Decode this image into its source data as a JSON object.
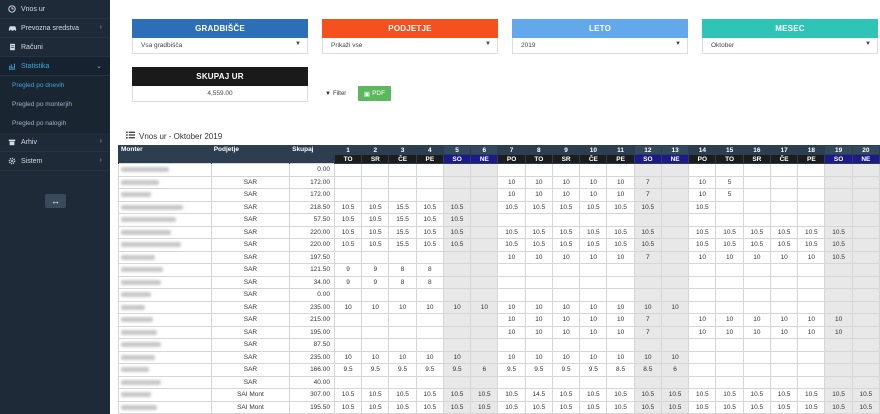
{
  "sidebar": {
    "items": [
      {
        "label": "Vnos ur",
        "icon": "clock-icon",
        "chevron": false
      },
      {
        "label": "Prevozna sredstva",
        "icon": "car-icon",
        "chevron": true
      },
      {
        "label": "Računi",
        "icon": "document-icon",
        "chevron": false
      },
      {
        "label": "Statistika",
        "icon": "chart-icon",
        "chevron": true,
        "active": true
      }
    ],
    "sub_items": [
      {
        "label": "Pregled po dnevih",
        "active": true
      },
      {
        "label": "Pregled po monterjih"
      },
      {
        "label": "Pregled po nalogih"
      }
    ],
    "bottom_items": [
      {
        "label": "Arhiv",
        "icon": "archive-icon",
        "chevron": true
      },
      {
        "label": "Sistem",
        "icon": "gear-icon",
        "chevron": true
      }
    ],
    "toggle_icon": "arrows-horizontal-icon"
  },
  "filters": {
    "gradbisce": {
      "title": "GRADBIŠČE",
      "value": "Vsa gradbišča",
      "color": "#2c6fb7"
    },
    "podjetje": {
      "title": "PODJETJE",
      "value": "Prikaži vse",
      "color": "#f4511e"
    },
    "leto": {
      "title": "LETO",
      "value": "2019",
      "color": "#64a8ec"
    },
    "mesec": {
      "title": "MESEC",
      "value": "Oktober",
      "color": "#2ec4b6"
    }
  },
  "total": {
    "title": "SKUPAJ UR",
    "value": "4,559.00",
    "color": "#1a1a1a"
  },
  "buttons": {
    "filter_label": "Filter",
    "pdf_label": "PDF",
    "pdf_color": "#5cb85c"
  },
  "table": {
    "title": "Vnos ur - Oktober 2019",
    "headers": {
      "monter": "Monter",
      "podjetje": "Podjetje",
      "skupaj": "Skupaj"
    },
    "days": [
      "1",
      "2",
      "3",
      "4",
      "5",
      "6",
      "7",
      "8",
      "9",
      "10",
      "11",
      "12",
      "13",
      "14",
      "15",
      "16",
      "17",
      "18",
      "19",
      "20"
    ],
    "dows": [
      "TO",
      "SR",
      "ČE",
      "PE",
      "SO",
      "NE",
      "PO",
      "TO",
      "SR",
      "ČE",
      "PE",
      "SO",
      "NE",
      "PO",
      "TO",
      "SR",
      "ČE",
      "PE",
      "SO",
      "NE"
    ],
    "rows": [
      {
        "podjetje": "",
        "skupaj": "0.00",
        "h": [
          "",
          "",
          "",
          "",
          "",
          "",
          "",
          "",
          "",
          "",
          "",
          "",
          "",
          "",
          "",
          "",
          "",
          "",
          "",
          ""
        ]
      },
      {
        "podjetje": "SAR",
        "skupaj": "172.00",
        "h": [
          "",
          "",
          "",
          "",
          "",
          "",
          "10",
          "10",
          "10",
          "10",
          "10",
          "7",
          "",
          "10",
          "5",
          "",
          "",
          "",
          "",
          ""
        ]
      },
      {
        "podjetje": "SAR",
        "skupaj": "172.00",
        "h": [
          "",
          "",
          "",
          "",
          "",
          "",
          "10",
          "10",
          "10",
          "10",
          "10",
          "7",
          "",
          "10",
          "5",
          "",
          "",
          "",
          "",
          ""
        ]
      },
      {
        "podjetje": "SAR",
        "skupaj": "218.50",
        "h": [
          "10.5",
          "10.5",
          "15.5",
          "10.5",
          "10.5",
          "",
          "10.5",
          "10.5",
          "10.5",
          "10.5",
          "10.5",
          "10.5",
          "",
          "10.5",
          "",
          "",
          "",
          "",
          "",
          ""
        ]
      },
      {
        "podjetje": "SAR",
        "skupaj": "57.50",
        "h": [
          "10.5",
          "10.5",
          "15.5",
          "10.5",
          "10.5",
          "",
          "",
          "",
          "",
          "",
          "",
          "",
          "",
          "",
          "",
          "",
          "",
          "",
          "",
          ""
        ]
      },
      {
        "podjetje": "SAR",
        "skupaj": "220.00",
        "h": [
          "10.5",
          "10.5",
          "15.5",
          "10.5",
          "10.5",
          "",
          "10.5",
          "10.5",
          "10.5",
          "10.5",
          "10.5",
          "10.5",
          "",
          "10.5",
          "10.5",
          "10.5",
          "10.5",
          "10.5",
          "10.5",
          ""
        ]
      },
      {
        "podjetje": "SAR",
        "skupaj": "220.00",
        "h": [
          "10.5",
          "10.5",
          "15.5",
          "10.5",
          "10.5",
          "",
          "10.5",
          "10.5",
          "10.5",
          "10.5",
          "10.5",
          "10.5",
          "",
          "10.5",
          "10.5",
          "10.5",
          "10.5",
          "10.5",
          "10.5",
          ""
        ]
      },
      {
        "podjetje": "SAR",
        "skupaj": "197.50",
        "h": [
          "",
          "",
          "",
          "",
          "",
          "",
          "10",
          "10",
          "10",
          "10",
          "10",
          "7",
          "",
          "10",
          "10",
          "10",
          "10",
          "10",
          "10.5",
          ""
        ]
      },
      {
        "podjetje": "SAR",
        "skupaj": "121.50",
        "h": [
          "9",
          "9",
          "8",
          "8",
          "",
          "",
          "",
          "",
          "",
          "",
          "",
          "",
          "",
          "",
          "",
          "",
          "",
          "",
          "",
          ""
        ]
      },
      {
        "podjetje": "SAR",
        "skupaj": "34.00",
        "h": [
          "9",
          "9",
          "8",
          "8",
          "",
          "",
          "",
          "",
          "",
          "",
          "",
          "",
          "",
          "",
          "",
          "",
          "",
          "",
          "",
          ""
        ]
      },
      {
        "podjetje": "SAR",
        "skupaj": "0.00",
        "h": [
          "",
          "",
          "",
          "",
          "",
          "",
          "",
          "",
          "",
          "",
          "",
          "",
          "",
          "",
          "",
          "",
          "",
          "",
          "",
          ""
        ]
      },
      {
        "podjetje": "SAR",
        "skupaj": "235.00",
        "h": [
          "10",
          "10",
          "10",
          "10",
          "10",
          "10",
          "10",
          "10",
          "10",
          "10",
          "10",
          "10",
          "10",
          "",
          "",
          "",
          "",
          "",
          "",
          ""
        ]
      },
      {
        "podjetje": "SAR",
        "skupaj": "215.00",
        "h": [
          "",
          "",
          "",
          "",
          "",
          "",
          "10",
          "10",
          "10",
          "10",
          "10",
          "7",
          "",
          "10",
          "10",
          "10",
          "10",
          "10",
          "10",
          ""
        ]
      },
      {
        "podjetje": "SAR",
        "skupaj": "195.00",
        "h": [
          "",
          "",
          "",
          "",
          "",
          "",
          "10",
          "10",
          "10",
          "10",
          "10",
          "7",
          "",
          "10",
          "10",
          "10",
          "10",
          "10",
          "10",
          ""
        ]
      },
      {
        "podjetje": "SAR",
        "skupaj": "87.50",
        "h": [
          "",
          "",
          "",
          "",
          "",
          "",
          "",
          "",
          "",
          "",
          "",
          "",
          "",
          "",
          "",
          "",
          "",
          "",
          "",
          ""
        ]
      },
      {
        "podjetje": "SAR",
        "skupaj": "235.00",
        "h": [
          "10",
          "10",
          "10",
          "10",
          "10",
          "",
          "10",
          "10",
          "10",
          "10",
          "10",
          "10",
          "10",
          "",
          "",
          "",
          "",
          "",
          "",
          ""
        ]
      },
      {
        "podjetje": "SAR",
        "skupaj": "166.00",
        "h": [
          "9.5",
          "9.5",
          "9.5",
          "9.5",
          "9.5",
          "6",
          "9.5",
          "9.5",
          "9.5",
          "9.5",
          "8.5",
          "8.5",
          "6",
          "",
          "",
          "",
          "",
          "",
          "",
          ""
        ]
      },
      {
        "podjetje": "SAR",
        "skupaj": "40.00",
        "h": [
          "",
          "",
          "",
          "",
          "",
          "",
          "",
          "",
          "",
          "",
          "",
          "",
          "",
          "",
          "",
          "",
          "",
          "",
          "",
          ""
        ]
      },
      {
        "podjetje": "SAI Mont",
        "skupaj": "307.00",
        "h": [
          "10.5",
          "10.5",
          "10.5",
          "10.5",
          "10.5",
          "10.5",
          "10.5",
          "14.5",
          "10.5",
          "10.5",
          "10.5",
          "10.5",
          "10.5",
          "10.5",
          "10.5",
          "10.5",
          "10.5",
          "10.5",
          "10.5",
          "10.5"
        ]
      },
      {
        "podjetje": "SAI Mont",
        "skupaj": "195.50",
        "h": [
          "10.5",
          "10.5",
          "10.5",
          "10.5",
          "10.5",
          "10.5",
          "10.5",
          "10.5",
          "10.5",
          "10.5",
          "10.5",
          "10.5",
          "10.5",
          "10.5",
          "10.5",
          "10.5",
          "10.5",
          "10.5",
          "10.5",
          "10.5"
        ]
      }
    ]
  }
}
